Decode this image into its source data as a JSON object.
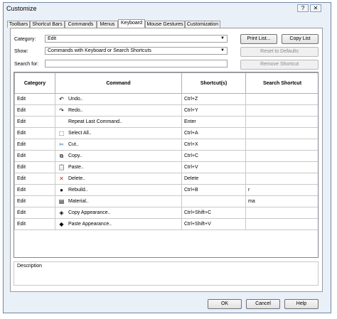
{
  "window": {
    "title": "Customize",
    "help_glyph": "?",
    "close_glyph": "✕"
  },
  "tabs": [
    {
      "label": "Toolbars",
      "active": false
    },
    {
      "label": "Shortcut Bars",
      "active": false
    },
    {
      "label": "Commands",
      "active": false
    },
    {
      "label": "Menus",
      "active": false
    },
    {
      "label": "Keyboard",
      "active": true
    },
    {
      "label": "Mouse Gestures",
      "active": false
    },
    {
      "label": "Customization",
      "active": false
    }
  ],
  "filters": {
    "category_label": "Category:",
    "category_value": "Edit",
    "show_label": "Show:",
    "show_value": "Commands with Keyboard or Search Shortcuts",
    "search_label": "Search for:",
    "search_value": ""
  },
  "buttons": {
    "print_list": "Print List...",
    "copy_list": "Copy List",
    "reset_to_defaults": "Reset to Defaults",
    "remove_shortcut": "Remove Shortcut"
  },
  "table": {
    "headers": [
      "Category",
      "Command",
      "Shortcut(s)",
      "Search Shortcut"
    ],
    "rows": [
      {
        "category": "Edit",
        "icon": "undo-icon",
        "glyph": "↶",
        "command": "Undo..",
        "shortcut": "Ctrl+Z",
        "search": ""
      },
      {
        "category": "Edit",
        "icon": "redo-icon",
        "glyph": "↷",
        "command": "Redo..",
        "shortcut": "Ctrl+Y",
        "search": ""
      },
      {
        "category": "Edit",
        "icon": "",
        "glyph": "",
        "command": "Repeat Last Command..",
        "shortcut": "Enter",
        "search": ""
      },
      {
        "category": "Edit",
        "icon": "select-all-icon",
        "glyph": "⬚",
        "command": "Select All..",
        "shortcut": "Ctrl+A",
        "search": ""
      },
      {
        "category": "Edit",
        "icon": "cut-icon",
        "glyph": "✂",
        "command": "Cut..",
        "shortcut": "Ctrl+X",
        "search": ""
      },
      {
        "category": "Edit",
        "icon": "copy-icon",
        "glyph": "⧉",
        "command": "Copy..",
        "shortcut": "Ctrl+C",
        "search": ""
      },
      {
        "category": "Edit",
        "icon": "paste-icon",
        "glyph": "📋",
        "command": "Paste..",
        "shortcut": "Ctrl+V",
        "search": ""
      },
      {
        "category": "Edit",
        "icon": "delete-icon",
        "glyph": "✕",
        "command": "Delete..",
        "shortcut": "Delete",
        "search": ""
      },
      {
        "category": "Edit",
        "icon": "rebuild-icon",
        "glyph": "●",
        "command": "Rebuild..",
        "shortcut": "Ctrl+B",
        "search": "r"
      },
      {
        "category": "Edit",
        "icon": "material-icon",
        "glyph": "▤",
        "command": "Material..",
        "shortcut": "",
        "search": "ma"
      },
      {
        "category": "Edit",
        "icon": "copy-appearance-icon",
        "glyph": "◈",
        "command": "Copy Appearance..",
        "shortcut": "Ctrl+Shift+C",
        "search": ""
      },
      {
        "category": "Edit",
        "icon": "paste-appearance-icon",
        "glyph": "◆",
        "command": "Paste Appearance..",
        "shortcut": "Ctrl+Shift+V",
        "search": ""
      }
    ]
  },
  "description": {
    "label": "Description"
  },
  "footer": {
    "ok": "OK",
    "cancel": "Cancel",
    "help": "Help"
  },
  "colors": {
    "window_bg": "#eaf0f8",
    "delete_icon": "#cc2222",
    "cut_icon": "#2a5fb0"
  }
}
